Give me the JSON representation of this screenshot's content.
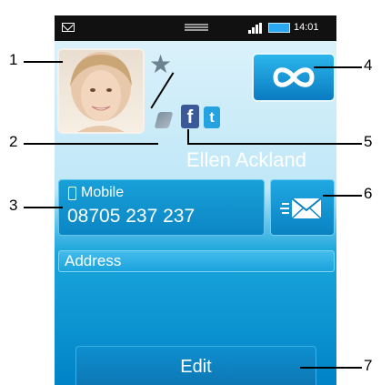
{
  "status_bar": {
    "time": "14:01",
    "icons": [
      "mail-icon",
      "drag-handle-icon",
      "signal-icon",
      "battery-icon"
    ]
  },
  "contact": {
    "name": "Ellen Ackland",
    "phone_type": "Mobile",
    "phone_number": "08705 237 237",
    "address_label": "Address"
  },
  "actions": {
    "edit_label": "Edit"
  },
  "social": {
    "facebook_glyph": "f",
    "twitter_glyph": "t"
  },
  "callouts": [
    "1",
    "2",
    "3",
    "4",
    "5",
    "6",
    "7"
  ],
  "colors": {
    "accent": "#0a82c2",
    "facebook": "#3b5998",
    "twitter": "#27a2e0"
  }
}
